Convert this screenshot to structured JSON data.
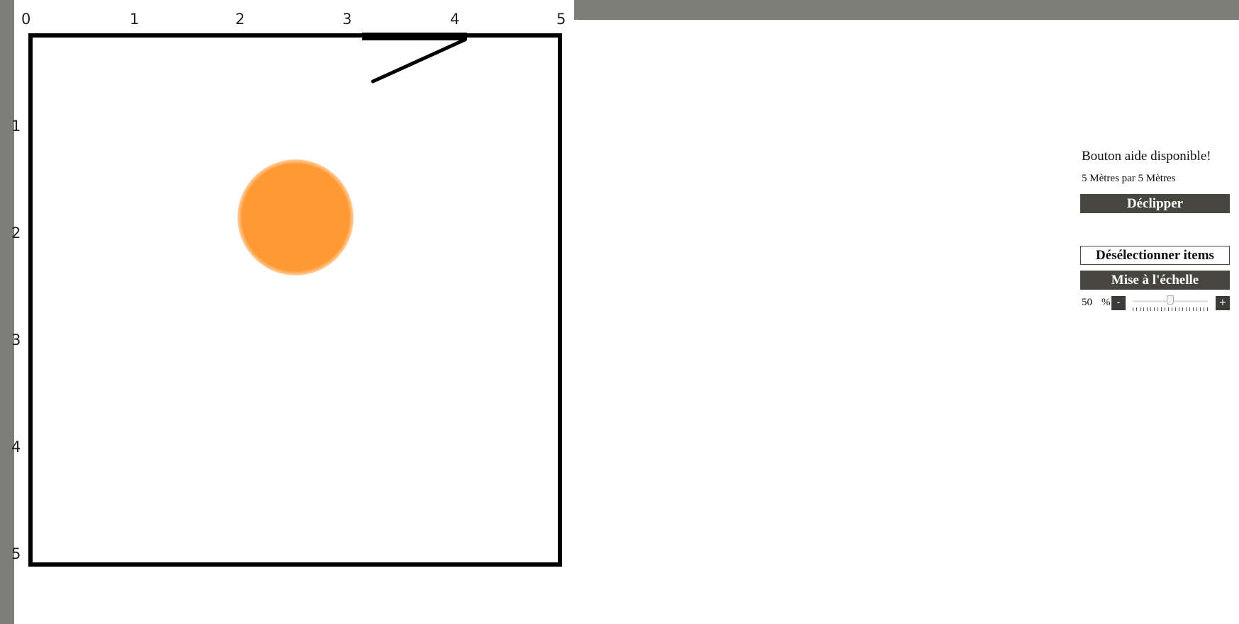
{
  "rulers": {
    "top_labels": [
      "0",
      "1",
      "2",
      "3",
      "4",
      "5"
    ],
    "left_labels": [
      "1",
      "2",
      "3",
      "4",
      "5"
    ]
  },
  "room": {
    "furniture": [
      {
        "name": "orange-round-table",
        "color": "#ff9933"
      },
      {
        "name": "door-with-swing",
        "color": "#000000"
      }
    ]
  },
  "panel": {
    "help_note": "Bouton aide disponible!",
    "dimensions": "5 Mètres par 5 Mètres",
    "unclip_label": "Déclipper",
    "deselect_label": "Désélectionner items",
    "scale_label": "Mise à l'échelle",
    "scale_value": "50",
    "scale_unit": "%",
    "minus_label": "-",
    "plus_label": "+",
    "slider_fraction": 0.5
  },
  "colors": {
    "ruler_bg": "#7e7e78",
    "button_dark": "#46463f",
    "table_orange": "#ff9933"
  }
}
